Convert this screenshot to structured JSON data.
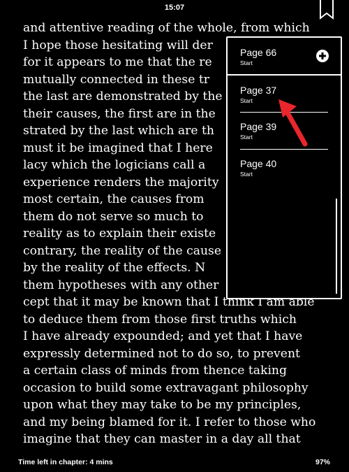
{
  "status_bar": {
    "time": "15:07",
    "bookmark_icon": "bookmark-icon"
  },
  "book_text": {
    "lines": [
      "and attentive reading of the whole, from which",
      "I hope those hesitating will der",
      "for it appears to me that the re",
      "mutually connected in these tr",
      "the last are demonstrated by the",
      "their causes, the first are in the",
      "strated by the last which are th",
      "must it be imagined that I here",
      "lacy which the logicians call a",
      "experience renders the majority",
      "most certain, the causes from",
      "them do not serve so much to",
      "reality as to explain their existe",
      "contrary, the reality of the cause",
      "by the reality of the effects. N",
      "them hypotheses with any other",
      "cept that it may be known that I think I am able",
      "to deduce them from those first truths which",
      "I have already expounded; and yet that I have",
      "expressly determined not to do so, to prevent",
      "a certain class of minds from thence taking",
      "occasion to build some extravagant philosophy",
      "upon what they may take to be my principles,",
      "and my being blamed for it. I refer to those who",
      "imagine that they can master in a day all that"
    ]
  },
  "bookmarks_popup": {
    "items": [
      {
        "page": "Page 66",
        "sub": "Start"
      },
      {
        "page": "Page 37",
        "sub": "Start"
      },
      {
        "page": "Page 39",
        "sub": "Start"
      },
      {
        "page": "Page 40",
        "sub": "Start"
      }
    ],
    "add_icon": "plus-circle-icon"
  },
  "footer": {
    "time_left": "Time left in chapter: 4 mins",
    "progress": "97%"
  },
  "colors": {
    "background": "#000000",
    "text": "#ffffff",
    "annotation_arrow": "#e8262c"
  }
}
